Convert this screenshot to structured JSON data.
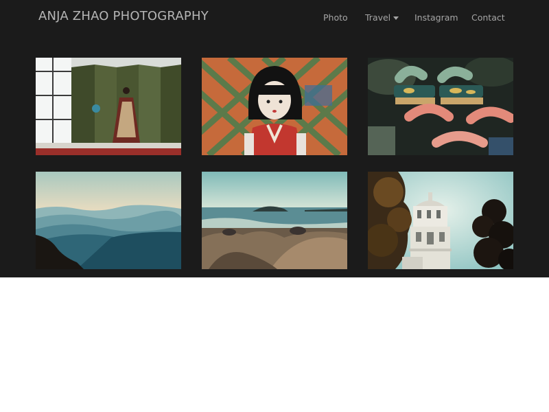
{
  "site": {
    "title": "ANJA ZHAO PHOTOGRAPHY"
  },
  "nav": {
    "items": [
      {
        "label": "Photo",
        "has_dropdown": false
      },
      {
        "label": "Travel",
        "has_dropdown": true
      },
      {
        "label": "Instagram",
        "has_dropdown": false
      },
      {
        "label": "Contact",
        "has_dropdown": false
      }
    ]
  },
  "colors": {
    "header_background": "#1b1b1b",
    "page_background": "#ffffff",
    "brand_text": "#b5b5b5",
    "nav_text": "#a6a6a6"
  },
  "gallery": {
    "photos": [
      {
        "subject": "kabuki-dancer-stage"
      },
      {
        "subject": "japanese-doll-lattice"
      },
      {
        "subject": "wooden-sandals-market"
      },
      {
        "subject": "misty-mountain-ridges"
      },
      {
        "subject": "rocky-seashore"
      },
      {
        "subject": "white-church-tower-trees"
      }
    ]
  }
}
